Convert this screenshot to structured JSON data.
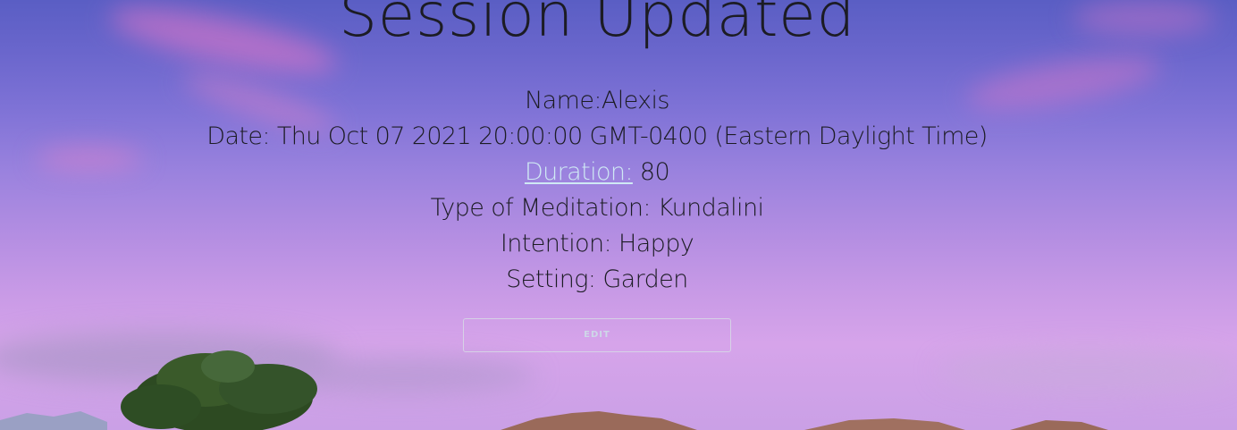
{
  "page": {
    "title": "Session Updated"
  },
  "session": {
    "name_label": "Name:",
    "name_value": "Alexis",
    "date_label": "Date:",
    "date_value": "Thu Oct 07 2021 20:00:00 GMT-0400 (Eastern Daylight Time)",
    "duration_label": "Duration:",
    "duration_value": "80",
    "type_label": "Type of Meditation:",
    "type_value": "Kundalini",
    "intention_label": "Intention:",
    "intention_value": "Happy",
    "setting_label": "Setting:",
    "setting_value": "Garden"
  },
  "actions": {
    "edit_label": "EDIT"
  },
  "colors": {
    "sky_top": "#5a5ec4",
    "sky_bottom": "#d6a4ea",
    "text": "#1c1c24",
    "link": "#cfe9f4"
  }
}
